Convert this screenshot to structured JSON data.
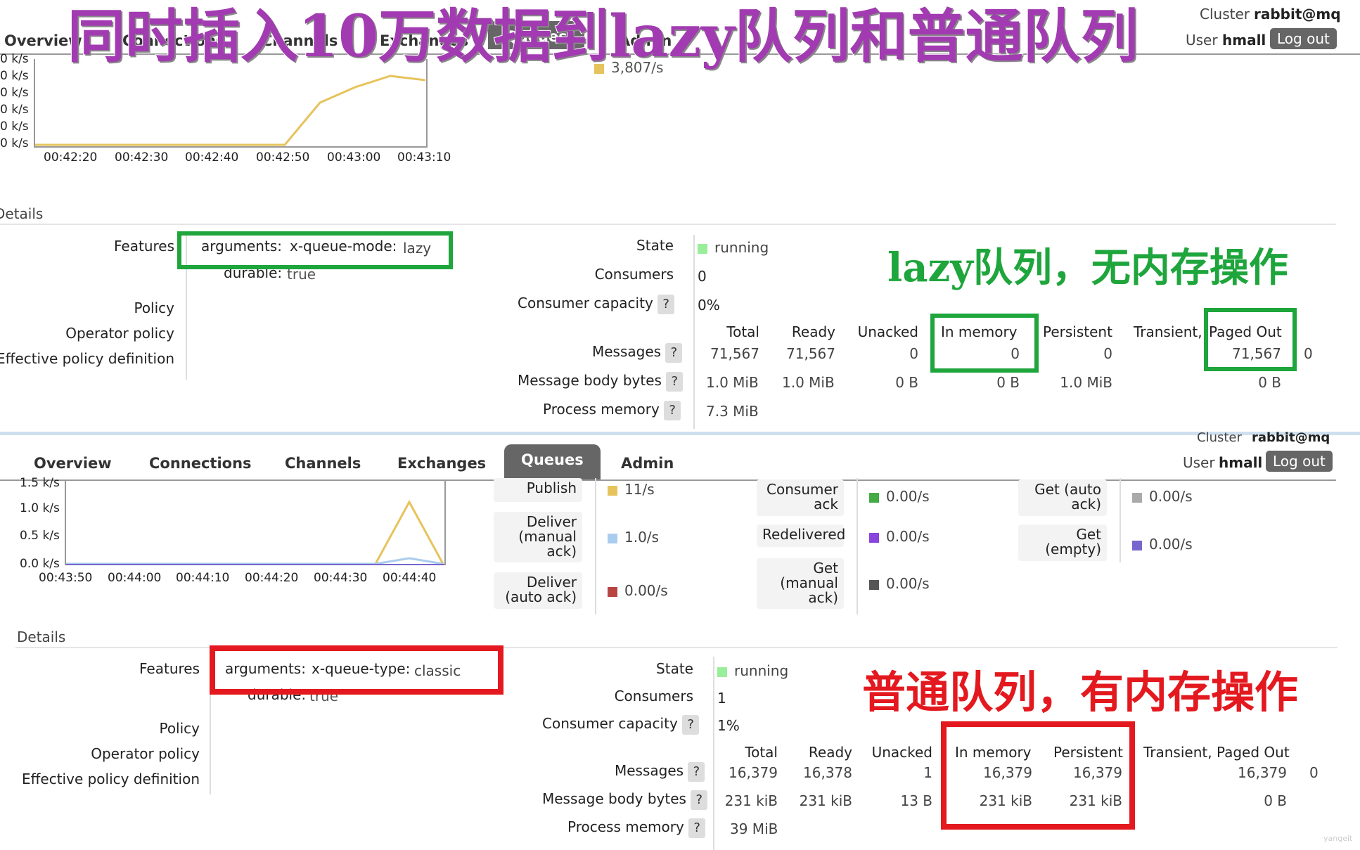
{
  "overlay_title": "同时插入10万数据到lazy队列和普通队列",
  "top": {
    "cluster_label": "Cluster",
    "cluster_value": "rabbit@mq",
    "user_label": "User",
    "user_value": "hmall",
    "logout": "Log out",
    "nav": [
      "Overview",
      "Connections",
      "Channels",
      "Exchanges",
      "Queues",
      "Admin"
    ],
    "chart": {
      "y_ticks": [
        "0 k/s",
        "0 k/s",
        "0 k/s",
        "0 k/s",
        "0 k/s",
        "0 k/s"
      ],
      "x_ticks": [
        "00:42:20",
        "00:42:30",
        "00:42:40",
        "00:42:50",
        "00:43:00",
        "00:43:10"
      ],
      "publish_rate": "3,807/s"
    },
    "details_title": "Details",
    "features_label": "Features",
    "arguments_key": "arguments:",
    "arg_name": "x-queue-mode:",
    "arg_value": "lazy",
    "durable_label": "durable:",
    "durable_value": "true",
    "policy": "Policy",
    "operator_policy": "Operator policy",
    "effective_policy": "Effective policy definition",
    "state_label": "State",
    "state_value": "running",
    "consumers_label": "Consumers",
    "consumers_value": "0",
    "capacity_label": "Consumer capacity",
    "capacity_value": "0%",
    "col_headers": [
      "Total",
      "Ready",
      "Unacked",
      "In memory",
      "Persistent",
      "Transient, Paged Out"
    ],
    "paged_out": "Paged Out",
    "transient": "Transient,",
    "messages_label": "Messages",
    "messages": [
      "71,567",
      "71,567",
      "0",
      "0",
      "0",
      "71,567",
      "0"
    ],
    "body_label": "Message body bytes",
    "body": [
      "1.0 MiB",
      "1.0 MiB",
      "0 B",
      "0 B",
      "1.0 MiB",
      "0 B"
    ],
    "process_label": "Process memory",
    "process_value": "7.3 MiB",
    "annotation": "lazy队列，无内存操作"
  },
  "bottom": {
    "cluster_label": "Cluster",
    "cluster_value": "rabbit@mq",
    "user_label": "User",
    "user_value": "hmall",
    "logout": "Log out",
    "nav": [
      "Overview",
      "Connections",
      "Channels",
      "Exchanges",
      "Queues",
      "Admin"
    ],
    "chart": {
      "y_ticks": [
        "1.5 k/s",
        "1.0 k/s",
        "0.5 k/s",
        "0.0 k/s"
      ],
      "x_ticks": [
        "00:43:50",
        "00:44:00",
        "00:44:10",
        "00:44:20",
        "00:44:30",
        "00:44:40"
      ],
      "publish_peak": 1.0,
      "deliver_peak": 0.1
    },
    "rates": {
      "publish_label": "Publish",
      "publish_value": "11/s",
      "deliver_manual_label": "Deliver (manual ack)",
      "deliver_manual_value": "1.0/s",
      "deliver_auto_label": "Deliver (auto ack)",
      "deliver_auto_value": "0.00/s",
      "consumer_ack_label": "Consumer ack",
      "consumer_ack_value": "0.00/s",
      "redelivered_label": "Redelivered",
      "redelivered_value": "0.00/s",
      "get_manual_label": "Get (manual ack)",
      "get_manual_value": "0.00/s",
      "get_auto_label": "Get (auto ack)",
      "get_auto_value": "0.00/s",
      "get_empty_label": "Get (empty)",
      "get_empty_value": "0.00/s"
    },
    "colors": {
      "publish": "#e6c35c",
      "deliver_manual": "#aaccee",
      "deliver_auto": "#b84444",
      "consumer_ack": "#44aa44",
      "redelivered": "#8844dd",
      "get_manual": "#555555",
      "get_auto": "#aaaaaa",
      "get_empty": "#7766cc"
    },
    "details_title": "Details",
    "features_label": "Features",
    "arguments_key": "arguments:",
    "arg_name": "x-queue-type:",
    "arg_value": "classic",
    "durable_label": "durable:",
    "durable_value": "true",
    "policy": "Policy",
    "operator_policy": "Operator policy",
    "effective_policy": "Effective policy definition",
    "state_label": "State",
    "state_value": "running",
    "consumers_label": "Consumers",
    "consumers_value": "1",
    "capacity_label": "Consumer capacity",
    "capacity_value": "1%",
    "col_headers": [
      "Total",
      "Ready",
      "Unacked",
      "In memory",
      "Persistent",
      "Transient, Paged Out"
    ],
    "messages_label": "Messages",
    "messages": [
      "16,379",
      "16,378",
      "1",
      "16,379",
      "16,379",
      "16,379",
      "0"
    ],
    "body_label": "Message body bytes",
    "body": [
      "231 kiB",
      "231 kiB",
      "13 B",
      "231 kiB",
      "231 kiB",
      "0 B"
    ],
    "process_label": "Process memory",
    "process_value": "39 MiB",
    "annotation": "普通队列，有内存操作"
  },
  "watermark": "yangeit"
}
